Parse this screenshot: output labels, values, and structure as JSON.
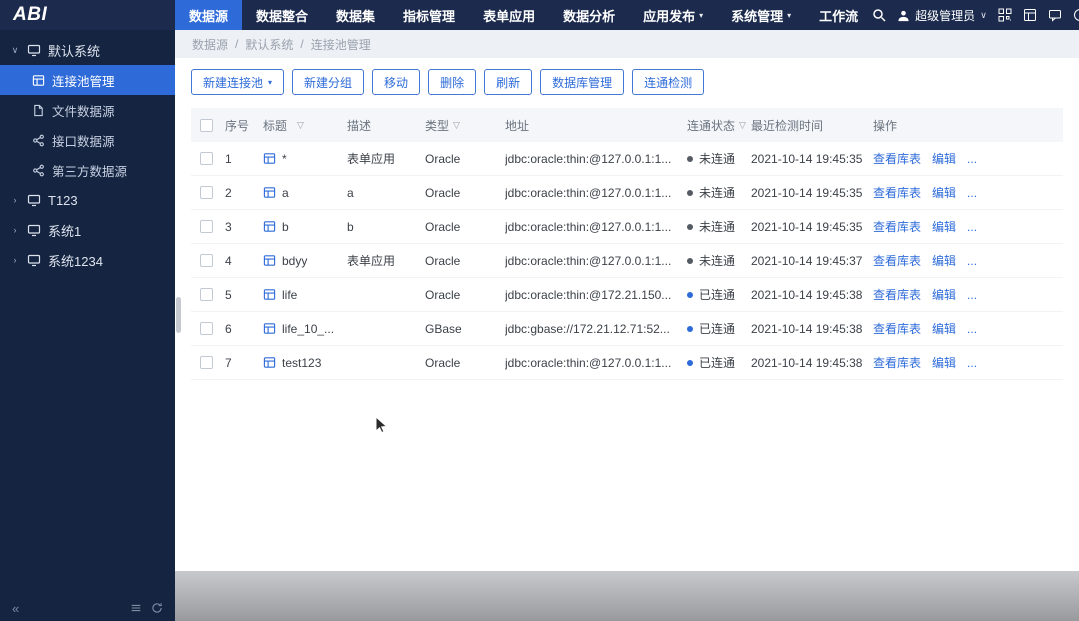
{
  "colors": {
    "accent": "#2e6bd9",
    "status_connected": "#2e6bd9",
    "status_disconnected": "#555b63"
  },
  "icons": {
    "filter": "▽",
    "caret_down": "▾",
    "caret_expanded": "∨",
    "caret_collapsed": "›",
    "collapse": "«"
  },
  "topbar": {
    "brand": "ABI",
    "menu": [
      {
        "label": "数据源"
      },
      {
        "label": "数据整合"
      },
      {
        "label": "数据集"
      },
      {
        "label": "指标管理"
      },
      {
        "label": "表单应用"
      },
      {
        "label": "数据分析"
      },
      {
        "label": "应用发布",
        "caret": "▾"
      },
      {
        "label": "系统管理",
        "caret": "▾"
      },
      {
        "label": "工作流"
      }
    ],
    "user_name": "超级管理员",
    "user_caret": "∨"
  },
  "sidebar": {
    "root": "默认系统",
    "children": [
      "连接池管理",
      "文件数据源",
      "接口数据源",
      "第三方数据源"
    ],
    "systems": [
      "T123",
      "系统1",
      "系统1234"
    ]
  },
  "breadcrumb": {
    "items": [
      "数据源",
      "默认系统",
      "连接池管理"
    ],
    "separator": "/"
  },
  "toolbar": [
    {
      "label": "新建连接池",
      "caret": "▾"
    },
    {
      "label": "新建分组"
    },
    {
      "label": "移动"
    },
    {
      "label": "删除"
    },
    {
      "label": "刷新"
    },
    {
      "label": "数据库管理"
    },
    {
      "label": "连通检测"
    }
  ],
  "table": {
    "headers": {
      "seq": "序号",
      "title": "标题",
      "desc": "描述",
      "type": "类型",
      "addr": "地址",
      "status": "连通状态",
      "time": "最近检测时间",
      "actions": "操作"
    },
    "row_actions": {
      "view": "查看库表",
      "edit": "编辑",
      "more": "..."
    },
    "rows": [
      {
        "seq": "1",
        "title": "*",
        "desc": "表单应用",
        "type": "Oracle",
        "addr": "jdbc:oracle:thin:@127.0.0.1:1...",
        "status": "未连通",
        "connected": false,
        "time": "2021-10-14 19:45:35"
      },
      {
        "seq": "2",
        "title": "a",
        "desc": "a",
        "type": "Oracle",
        "addr": "jdbc:oracle:thin:@127.0.0.1:1...",
        "status": "未连通",
        "connected": false,
        "time": "2021-10-14 19:45:35"
      },
      {
        "seq": "3",
        "title": "b",
        "desc": "b",
        "type": "Oracle",
        "addr": "jdbc:oracle:thin:@127.0.0.1:1...",
        "status": "未连通",
        "connected": false,
        "time": "2021-10-14 19:45:35"
      },
      {
        "seq": "4",
        "title": "bdyy",
        "desc": "表单应用",
        "type": "Oracle",
        "addr": "jdbc:oracle:thin:@127.0.0.1:1...",
        "status": "未连通",
        "connected": false,
        "time": "2021-10-14 19:45:37"
      },
      {
        "seq": "5",
        "title": "life",
        "desc": "",
        "type": "Oracle",
        "addr": "jdbc:oracle:thin:@172.21.150...",
        "status": "已连通",
        "connected": true,
        "time": "2021-10-14 19:45:38"
      },
      {
        "seq": "6",
        "title": "life_10_...",
        "desc": "",
        "type": "GBase",
        "addr": "jdbc:gbase://172.21.12.71:52...",
        "status": "已连通",
        "connected": true,
        "time": "2021-10-14 19:45:38"
      },
      {
        "seq": "7",
        "title": "test123",
        "desc": "",
        "type": "Oracle",
        "addr": "jdbc:oracle:thin:@127.0.0.1:1...",
        "status": "已连通",
        "connected": true,
        "time": "2021-10-14 19:45:38"
      }
    ]
  }
}
